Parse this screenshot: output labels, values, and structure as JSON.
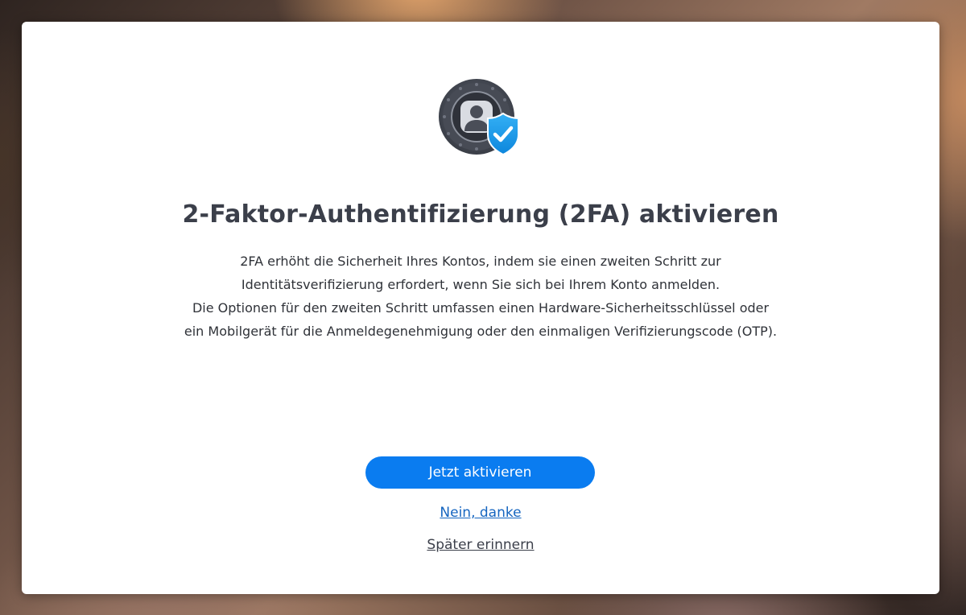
{
  "dialog": {
    "icon": "account-shield-check-icon",
    "title": "2-Faktor-Authentifizierung (2FA) aktivieren",
    "description_lines": [
      "2FA erhöht die Sicherheit Ihres Kontos, indem sie einen zweiten Schritt zur",
      "Identitätsverifizierung erfordert, wenn Sie sich bei Ihrem Konto anmelden.",
      "Die Optionen für den zweiten Schritt umfassen einen Hardware-Sicherheitsschlüssel oder",
      "ein Mobilgerät für die Anmeldegenehmigung oder den einmaligen Verifizierungscode (OTP)."
    ],
    "primary_button": "Jetzt aktivieren",
    "decline_link": "Nein, danke",
    "later_link": "Später erinnern"
  },
  "colors": {
    "primary": "#0a7cf0",
    "link": "#1565c0",
    "title": "#3b3f4a",
    "shield": "#1e9be8"
  }
}
